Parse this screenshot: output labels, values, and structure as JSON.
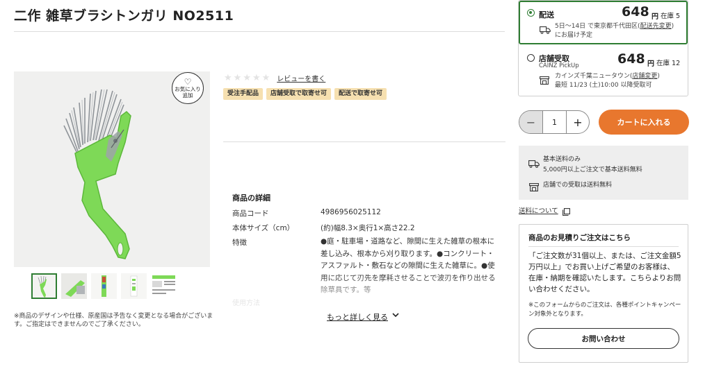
{
  "product": {
    "title": "二作 雑草ブラシトンガリ NO2511",
    "favorite_label": "お気に入り\n追加",
    "disclaimer": "※商品のデザインや仕様、原産国は予告なく変更となる場合がございます。ご指定はできませんのでご了承ください。",
    "thumbnail_count": 5
  },
  "reviews": {
    "star_count": 5,
    "rating": 0,
    "link_label": "レビューを書く"
  },
  "badges": [
    "受注手配品",
    "店舗受取で取寄せ可",
    "配送で取寄せ可"
  ],
  "details": {
    "title": "商品の詳細",
    "rows": [
      {
        "label": "商品コード",
        "value": "4986956025112"
      },
      {
        "label": "本体サイズ（cm）",
        "value": "(約)幅8.3×奥行1×高さ22.2"
      },
      {
        "label": "特徴",
        "value": "●庭・駐車場・道路など、隙間に生えた雑草の根本に差し込み、根本から刈り取ります。●コンクリート・アスファルト・敷石などの隙間に生えた雑草に。●使用に応じて刃先を摩耗させることで波刃を作り出せる除草具です。等"
      }
    ],
    "faded_label": "使用方法",
    "more_label": "もっと詳しく見る"
  },
  "delivery": {
    "label": "配送",
    "price": "648",
    "yen": "円",
    "stock": "在庫 5",
    "date_text": "5日〜14日 で東京都千代田区",
    "change_link": "配送先変更",
    "date_suffix": "にお届け予定",
    "selected": true
  },
  "store_pickup": {
    "label": "店舗受取",
    "sublabel": "CAINZ PickUp",
    "price": "648",
    "yen": "円",
    "stock": "在庫 12",
    "store_name": "カインズ千葉ニュータウン",
    "store_change_link": "店舗変更",
    "pickup_date": "最短 11/23 (土)10:00 以降受取可",
    "selected": false
  },
  "cart": {
    "quantity": "1",
    "minus": "−",
    "plus": "+",
    "add_label": "カートに入れる"
  },
  "shipping_info": {
    "line1": "基本送料のみ",
    "line2": "5,000円以上ご注文で基本送料無料",
    "line3": "店舗での受取は送料無料",
    "fee_link": "送料について"
  },
  "quote": {
    "title": "商品のお見積りご注文はこちら",
    "body": "「ご注文数が31個以上、または、ご注文金額5万円以上」でお買い上げご希望のお客様は、在庫・納期を確認いたします。こちらよりお問い合わせください。",
    "note": "※このフォームからのご注文は、各種ポイントキャンペーン対象外となります。",
    "button_label": "お問い合わせ"
  },
  "colors": {
    "accent_green": "#2e7d32",
    "cart_orange": "#e8772e",
    "badge_bg": "#f6e0b0",
    "tool_green": "#7ed957"
  }
}
